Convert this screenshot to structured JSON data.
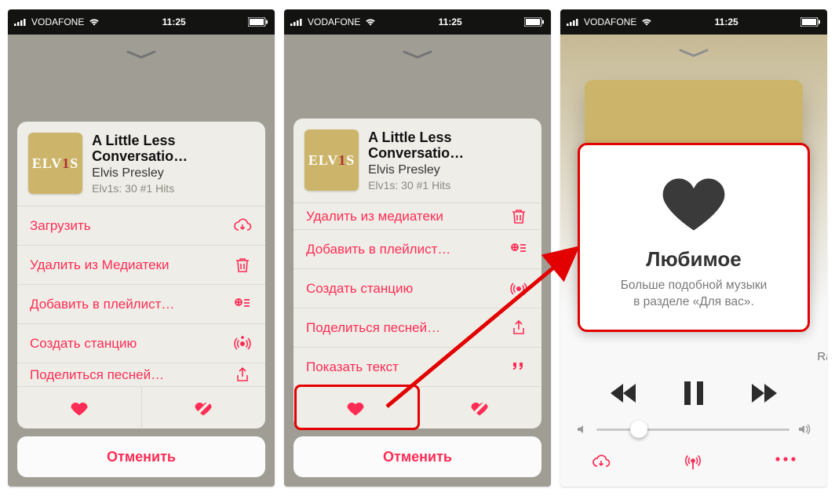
{
  "statusbar": {
    "carrier": "VODAFONE",
    "time": "11:25"
  },
  "song": {
    "title": "A Little Less Conversatio…",
    "artist": "Elvis Presley",
    "album": "Elv1s: 30 #1 Hits",
    "art_text": "ELV",
    "art_number": "1",
    "art_suffix": "S"
  },
  "menu_a": {
    "download": "Загрузить",
    "delete_library": "Удалить из Медиатеки",
    "add_playlist": "Добавить в плейлист…",
    "create_station": "Создать станцию",
    "share_song": "Поделиться песней…"
  },
  "menu_b": {
    "delete_library_trunc": "Удалить из медиатеки",
    "add_playlist": "Добавить в плейлист…",
    "create_station": "Создать станцию",
    "share_song": "Поделиться песней…",
    "show_lyrics": "Показать текст"
  },
  "cancel": "Отменить",
  "favorite": {
    "title": "Любимое",
    "desc_line1": "Больше подобной музыки",
    "desc_line2": "в разделе «Для вас»."
  },
  "rac_hint": "Rac"
}
